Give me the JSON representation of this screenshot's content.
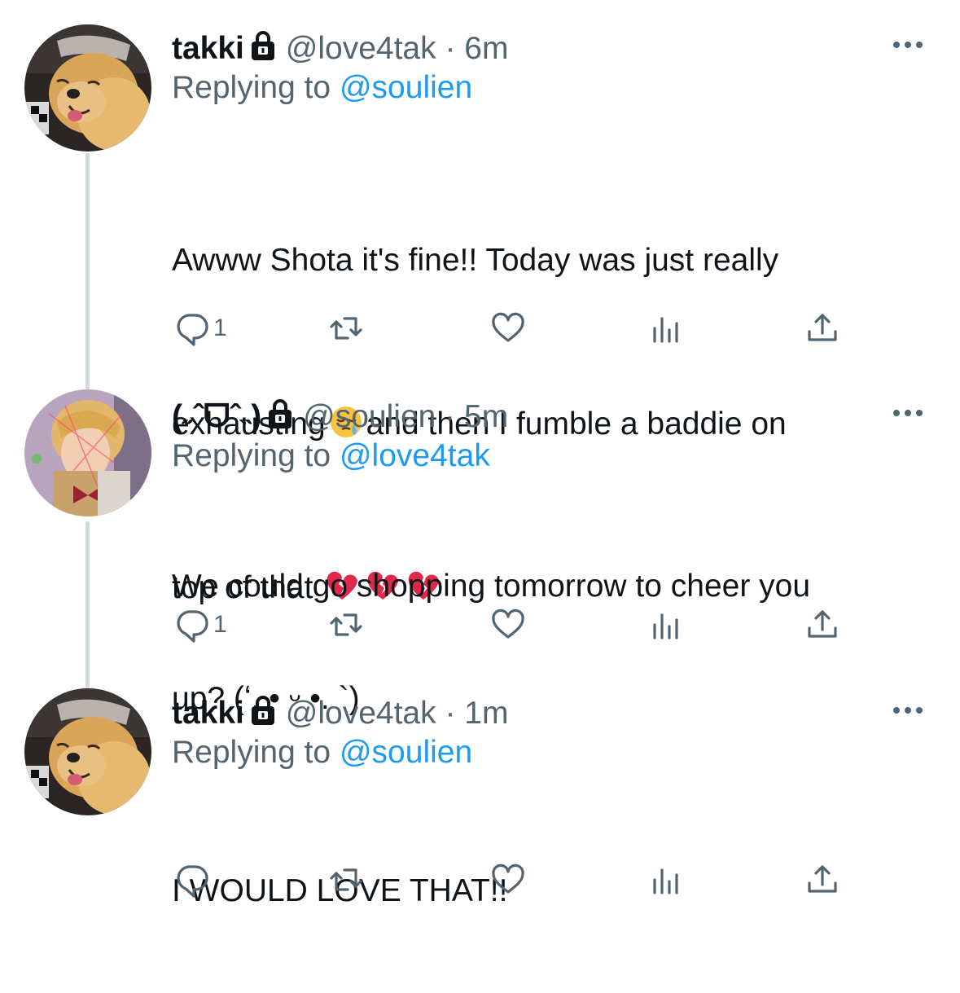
{
  "tweets": [
    {
      "name": "takki",
      "handle": "@love4tak",
      "dot": "·",
      "time": "6m",
      "replying_prefix": "Replying to",
      "replying_to": "@soulien",
      "text_line1": "Awww Shota it's fine!! Today was just really",
      "text_line2a": "exhausting",
      "text_line2b": "and then I fumble a baddie on",
      "text_line3": "top of that",
      "reply_count": "1",
      "avatar": "golden-retriever-avatar"
    },
    {
      "name": "(˶ˆᗜˆ˵)",
      "handle": "@soulien",
      "dot": "·",
      "time": "5m",
      "replying_prefix": "Replying to",
      "replying_to": "@love4tak",
      "text_line1": "We could go shopping tomorrow to cheer you",
      "text_line2": "up? (ʻ. • ᵕ •. `)",
      "reply_count": "1",
      "avatar": "person-avatar"
    },
    {
      "name": "takki",
      "handle": "@love4tak",
      "dot": "·",
      "time": "1m",
      "replying_prefix": "Replying to",
      "replying_to": "@soulien",
      "text_line1": "I WOULD LOVE THAT!!",
      "reply_count": "",
      "avatar": "golden-retriever-avatar"
    }
  ],
  "icons": {
    "lock": "lock-icon",
    "more": "more-icon",
    "reply": "reply-icon",
    "retweet": "retweet-icon",
    "like": "like-icon",
    "views": "views-icon",
    "share": "share-icon",
    "sleepy_emoji": "sleepy-face-emoji",
    "broken_heart": "broken-heart-emoji"
  },
  "colors": {
    "link": "#1d9bf0",
    "secondary": "#536471",
    "thread_line": "#cfd9de",
    "broken_heart": "#e0284a"
  }
}
